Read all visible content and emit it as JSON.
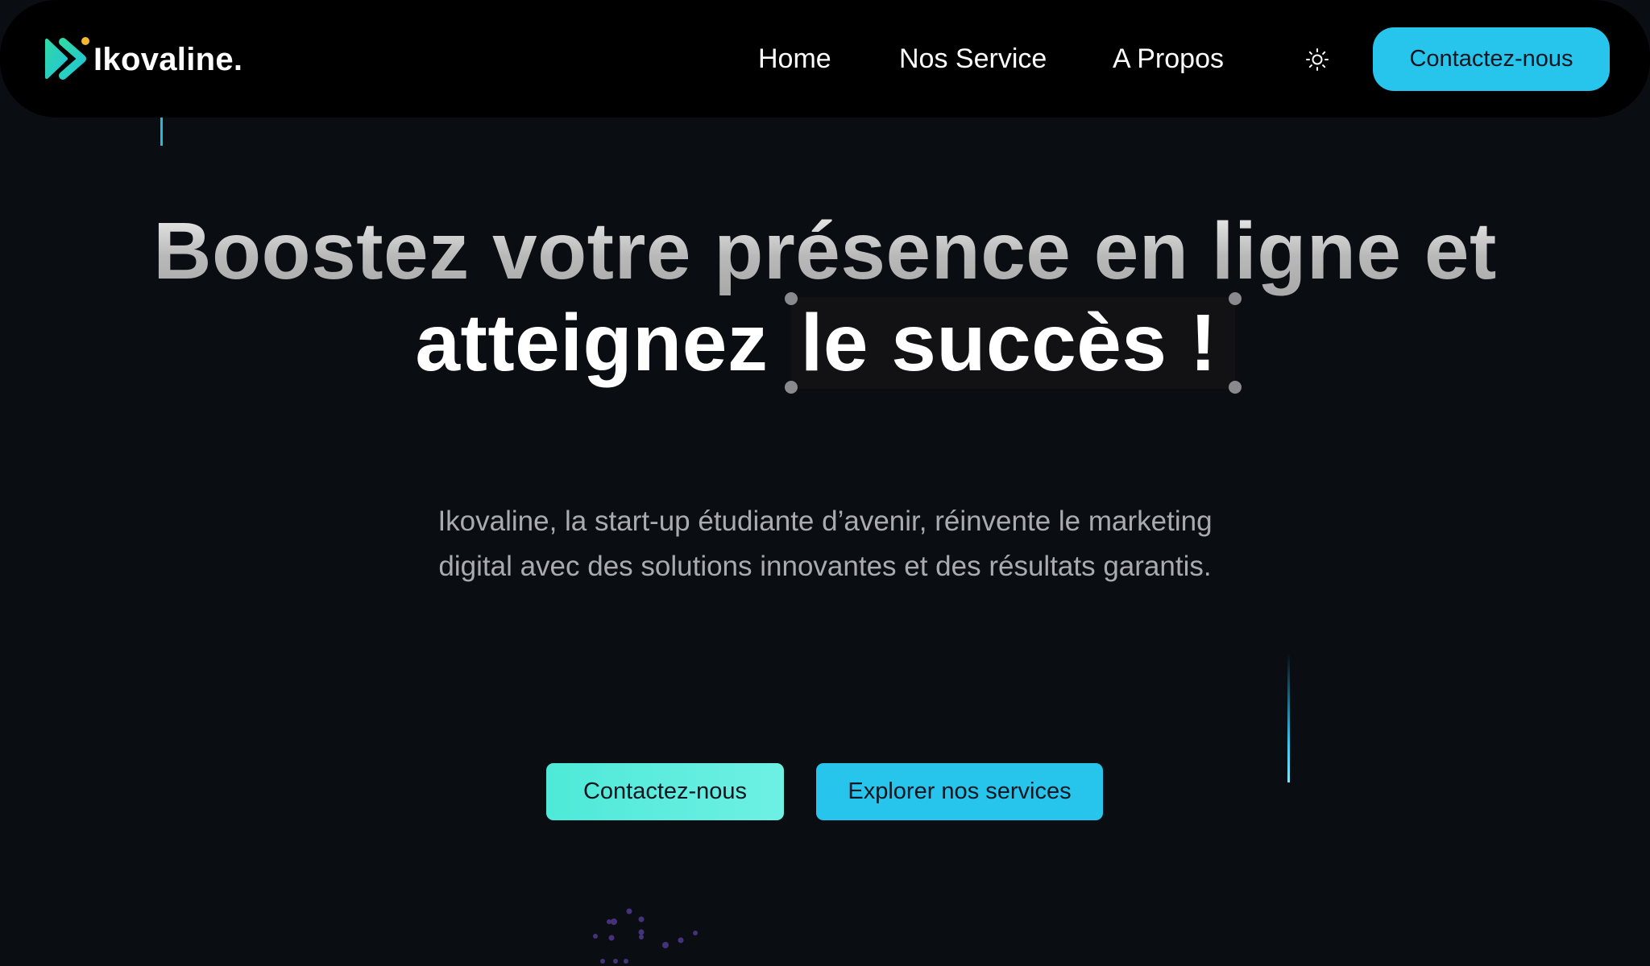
{
  "brand": {
    "name": "Ikovaline."
  },
  "nav": {
    "links": [
      "Home",
      "Nos Service",
      "A Propos"
    ],
    "theme_toggle_icon": "sun-icon",
    "cta_label": "Contactez-nous"
  },
  "hero": {
    "title_line1": "Boostez votre présence en ligne et",
    "title_line2_prefix": "atteignez",
    "title_line2_highlight": "le succès !",
    "subtitle": "Ikovaline, la start-up étudiante d’avenir, réinvente le marketing digital avec des solutions innovantes et des résultats garantis.",
    "primary_button": "Contactez-nous",
    "secondary_button": "Explorer nos services"
  },
  "colors": {
    "accent_cyan": "#27c4ec",
    "accent_teal": "#5eeee0",
    "background": "#0a0d12",
    "navbar": "#000000"
  }
}
